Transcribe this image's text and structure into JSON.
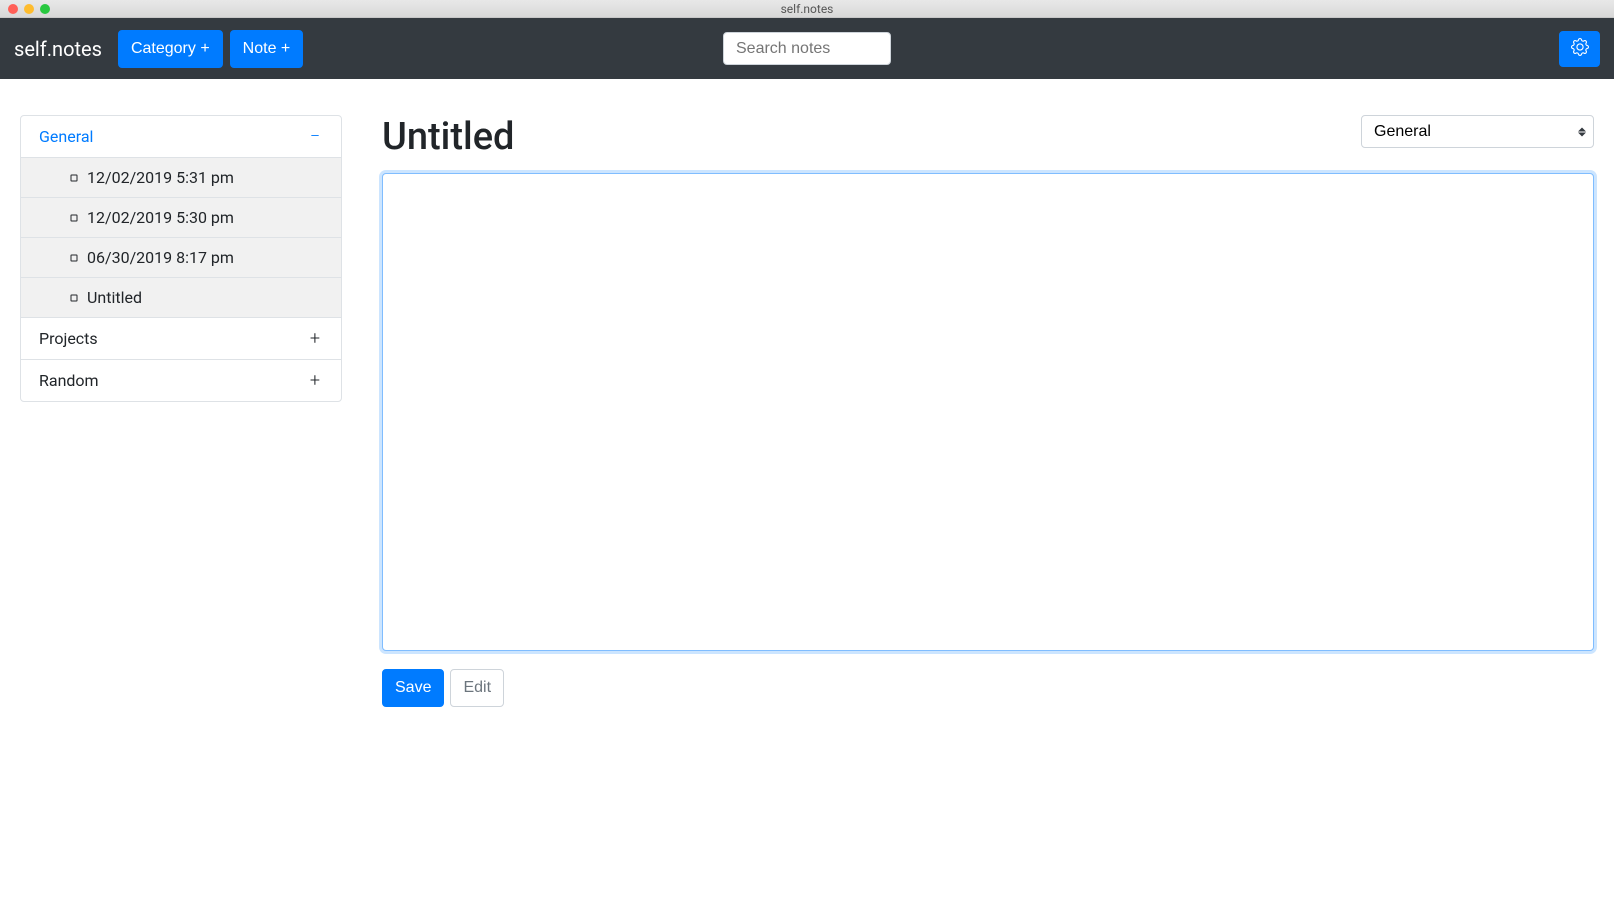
{
  "window": {
    "title": "self.notes"
  },
  "navbar": {
    "brand": "self.notes",
    "category_button": "Category +",
    "note_button": "Note +",
    "search_placeholder": "Search notes"
  },
  "sidebar": {
    "categories": [
      {
        "name": "General",
        "expanded": true,
        "notes": [
          {
            "label": "12/02/2019 5:31 pm"
          },
          {
            "label": "12/02/2019 5:30 pm"
          },
          {
            "label": "06/30/2019 8:17 pm"
          },
          {
            "label": "Untitled"
          }
        ]
      },
      {
        "name": "Projects",
        "expanded": false
      },
      {
        "name": "Random",
        "expanded": false
      }
    ]
  },
  "editor": {
    "title": "Untitled",
    "selected_category": "General",
    "body": "",
    "save_label": "Save",
    "edit_label": "Edit"
  },
  "colors": {
    "primary": "#007bff",
    "navbar_bg": "#343a40"
  }
}
